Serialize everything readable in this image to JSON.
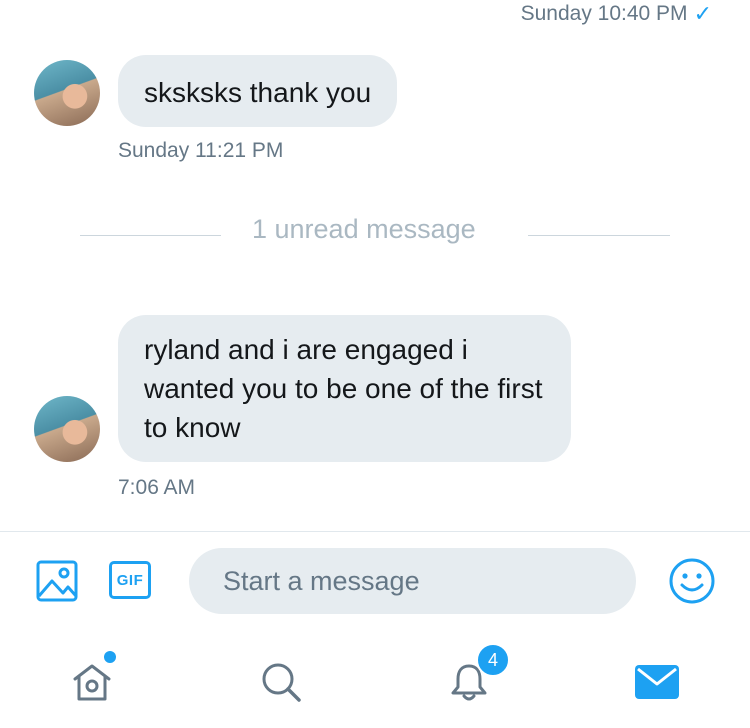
{
  "conversation": {
    "sent_timestamp": "Sunday 10:40 PM",
    "read_indicator": "✓",
    "messages": [
      {
        "text": "sksksks thank you",
        "timestamp": "Sunday 11:21 PM"
      },
      {
        "text": "ryland and i are engaged i wanted you to be one of the first to know",
        "timestamp": "7:06 AM"
      }
    ],
    "unread_divider": "1 unread message"
  },
  "composer": {
    "placeholder": "Start a message",
    "image_icon": "image-icon",
    "gif_label": "GIF",
    "emoji_icon": "smiley-icon"
  },
  "tab_bar": {
    "items": [
      {
        "name": "home",
        "icon": "home-icon",
        "has_dot": true
      },
      {
        "name": "search",
        "icon": "search-icon"
      },
      {
        "name": "notifications",
        "icon": "bell-icon",
        "badge": "4"
      },
      {
        "name": "messages",
        "icon": "mail-icon",
        "active": true
      }
    ]
  },
  "colors": {
    "accent": "#1da1f2",
    "bubble": "#e6ecf0",
    "meta_text": "#657786",
    "inactive_icon": "#657786"
  }
}
